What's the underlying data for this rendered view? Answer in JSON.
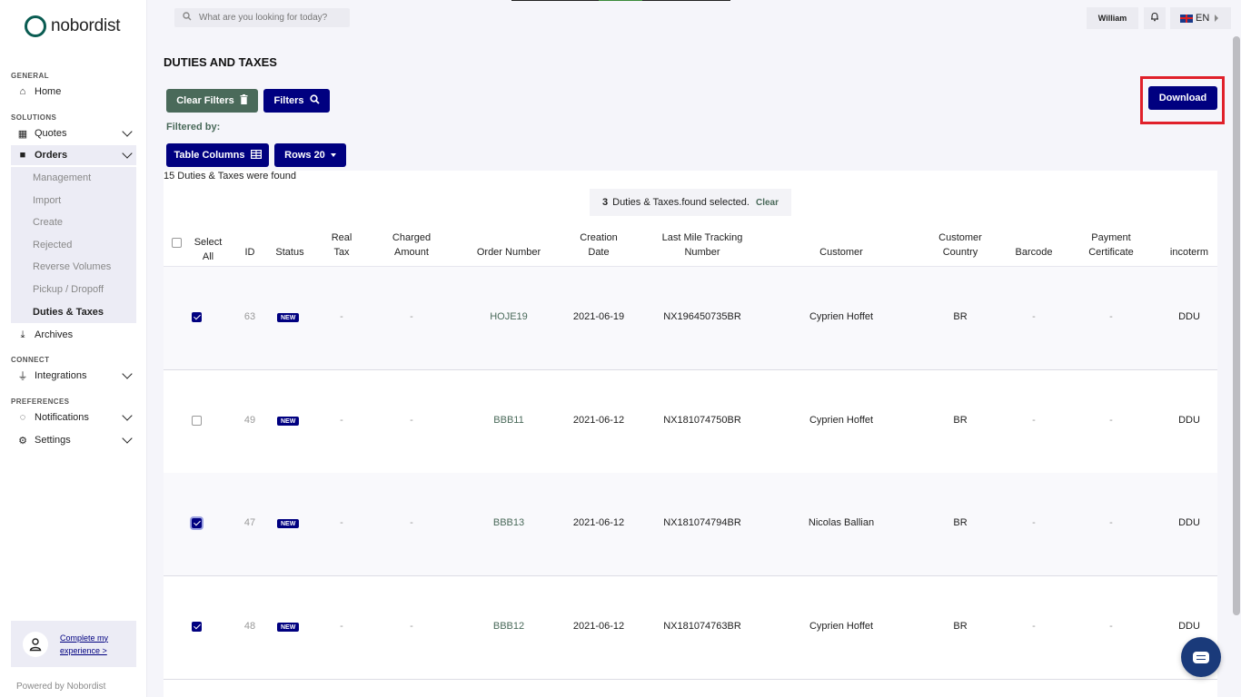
{
  "brand": {
    "name": "nobordist",
    "powered_by": "Powered by Nobordist",
    "accent": "#000080",
    "logo_color": "#0a5c52"
  },
  "sidebar": {
    "sections": {
      "general": "GENERAL",
      "solutions": "SOLUTIONS",
      "connect": "CONNECT",
      "preferences": "PREFERENCES"
    },
    "items": {
      "home": "Home",
      "quotes": "Quotes",
      "orders": "Orders",
      "archives": "Archives",
      "integrations": "Integrations",
      "notifications": "Notifications",
      "settings": "Settings"
    },
    "orders_sub": [
      "Management",
      "Import",
      "Create",
      "Rejected",
      "Reverse Volumes",
      "Pickup / Dropoff",
      "Duties & Taxes"
    ],
    "profile_link": "Complete my experience >"
  },
  "topbar": {
    "search_placeholder": "What are you looking for today?",
    "user": "William",
    "language": "EN"
  },
  "page": {
    "title": "DUTIES AND TAXES",
    "clear_filters": "Clear Filters",
    "filters": "Filters",
    "filtered_by": "Filtered by:",
    "table_columns": "Table Columns",
    "rows": "Rows 20",
    "download": "Download",
    "found_text": "15 Duties & Taxes were found",
    "selected_count": "3",
    "selected_text": "Duties & Taxes.found selected.",
    "selected_clear": "Clear"
  },
  "table": {
    "headers": {
      "select_all": "Select All",
      "id": "ID",
      "status": "Status",
      "real_tax": "Real Tax",
      "charged_amount": "Charged Amount",
      "order_number": "Order Number",
      "creation_date": "Creation Date",
      "tracking": "Last Mile Tracking Number",
      "customer": "Customer",
      "customer_country": "Customer Country",
      "barcode": "Barcode",
      "payment_certificate": "Payment Certificate",
      "incoterm": "incoterm"
    },
    "rows": [
      {
        "checked": true,
        "id": "63",
        "status": "NEW",
        "real_tax": "-",
        "charged_amount": "-",
        "order_number": "HOJE19",
        "creation_date": "2021-06-19",
        "tracking": "NX196450735BR",
        "customer": "Cyprien Hoffet",
        "country": "BR",
        "barcode": "-",
        "payment_certificate": "-",
        "incoterm": "DDU"
      },
      {
        "checked": false,
        "id": "49",
        "status": "NEW",
        "real_tax": "-",
        "charged_amount": "-",
        "order_number": "BBB11",
        "creation_date": "2021-06-12",
        "tracking": "NX181074750BR",
        "customer": "Cyprien Hoffet",
        "country": "BR",
        "barcode": "-",
        "payment_certificate": "-",
        "incoterm": "DDU"
      },
      {
        "checked": true,
        "id": "47",
        "status": "NEW",
        "real_tax": "-",
        "charged_amount": "-",
        "order_number": "BBB13",
        "creation_date": "2021-06-12",
        "tracking": "NX181074794BR",
        "customer": "Nicolas Ballian",
        "country": "BR",
        "barcode": "-",
        "payment_certificate": "-",
        "incoterm": "DDU"
      },
      {
        "checked": true,
        "id": "48",
        "status": "NEW",
        "real_tax": "-",
        "charged_amount": "-",
        "order_number": "BBB12",
        "creation_date": "2021-06-12",
        "tracking": "NX181074763BR",
        "customer": "Cyprien Hoffet",
        "country": "BR",
        "barcode": "-",
        "payment_certificate": "-",
        "incoterm": "DDU"
      }
    ]
  }
}
